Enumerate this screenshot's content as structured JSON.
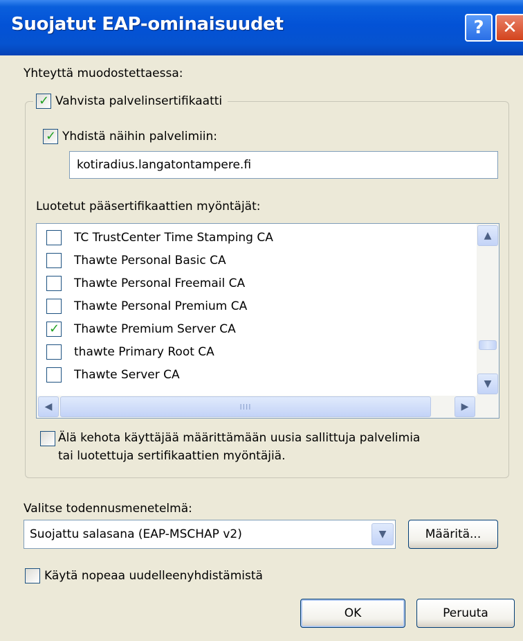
{
  "window": {
    "title": "Suojatut EAP-ominaisuudet",
    "help_glyph": "?",
    "close_glyph": "✕"
  },
  "connect_label": "Yhteyttä muodostettaessa:",
  "verify_cert": {
    "label": "Vahvista palvelinsertifikaatti",
    "checked": true
  },
  "connect_servers": {
    "label": "Yhdistä näihin palvelimiin:",
    "checked": true,
    "value": "kotiradius.langatontampere.fi"
  },
  "trusted_label": "Luotetut pääsertifikaattien myöntäjät:",
  "cert_list": [
    {
      "label": "TC TrustCenter Time Stamping CA",
      "checked": false
    },
    {
      "label": "Thawte Personal Basic CA",
      "checked": false
    },
    {
      "label": "Thawte Personal Freemail CA",
      "checked": false
    },
    {
      "label": "Thawte Personal Premium CA",
      "checked": false
    },
    {
      "label": "Thawte Premium Server CA",
      "checked": true
    },
    {
      "label": "thawte Primary Root CA",
      "checked": false
    },
    {
      "label": "Thawte Server CA",
      "checked": false
    }
  ],
  "scroll_glyphs": {
    "up": "▲",
    "down": "▼",
    "left": "◀",
    "right": "▶",
    "grip": "IIII"
  },
  "dont_prompt": {
    "line1": "Älä kehota käyttäjää määrittämään uusia sallittuja palvelimia",
    "line2": "tai luotettuja sertifikaattien myöntäjiä.",
    "checked": false
  },
  "auth_label": "Valitse todennusmenetelmä:",
  "auth_method": {
    "value": "Suojattu salasana (EAP-MSCHAP v2)",
    "arrow": "▼"
  },
  "configure_button": "Määritä...",
  "fast_reconnect": {
    "label": "Käytä nopeaa uudelleenyhdistämistä",
    "checked": false
  },
  "ok_button": "OK",
  "cancel_button": "Peruuta",
  "check_glyph": "✓"
}
